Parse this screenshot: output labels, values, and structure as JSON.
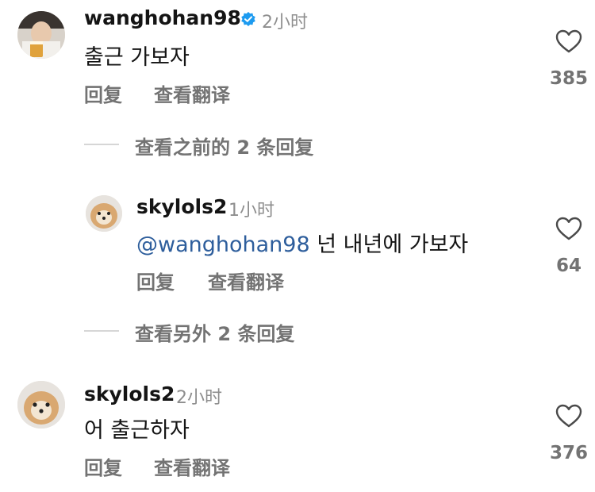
{
  "comments": [
    {
      "username": "wanghohan98",
      "time": "2小时",
      "text": "출근 가보자",
      "reply_label": "回复",
      "translate_label": "查看翻译",
      "likes": "385",
      "verified": true,
      "view_replies": "查看之前的 2 条回复"
    },
    {
      "username": "skylols2",
      "time": "1小时",
      "mention": "@wanghohan98",
      "text": " 넌 내년에 가보자",
      "reply_label": "回复",
      "translate_label": "查看翻译",
      "likes": "64",
      "view_replies": "查看另外 2 条回复"
    },
    {
      "username": "skylols2",
      "time": "2小时",
      "text": "어 출근하자",
      "reply_label": "回复",
      "translate_label": "查看翻译",
      "likes": "376"
    }
  ],
  "colors": {
    "username": "#141414",
    "meta": "#8e8e8e",
    "action": "#737373",
    "mention": "#2e5e9c",
    "verified": "#1d9bf0"
  }
}
